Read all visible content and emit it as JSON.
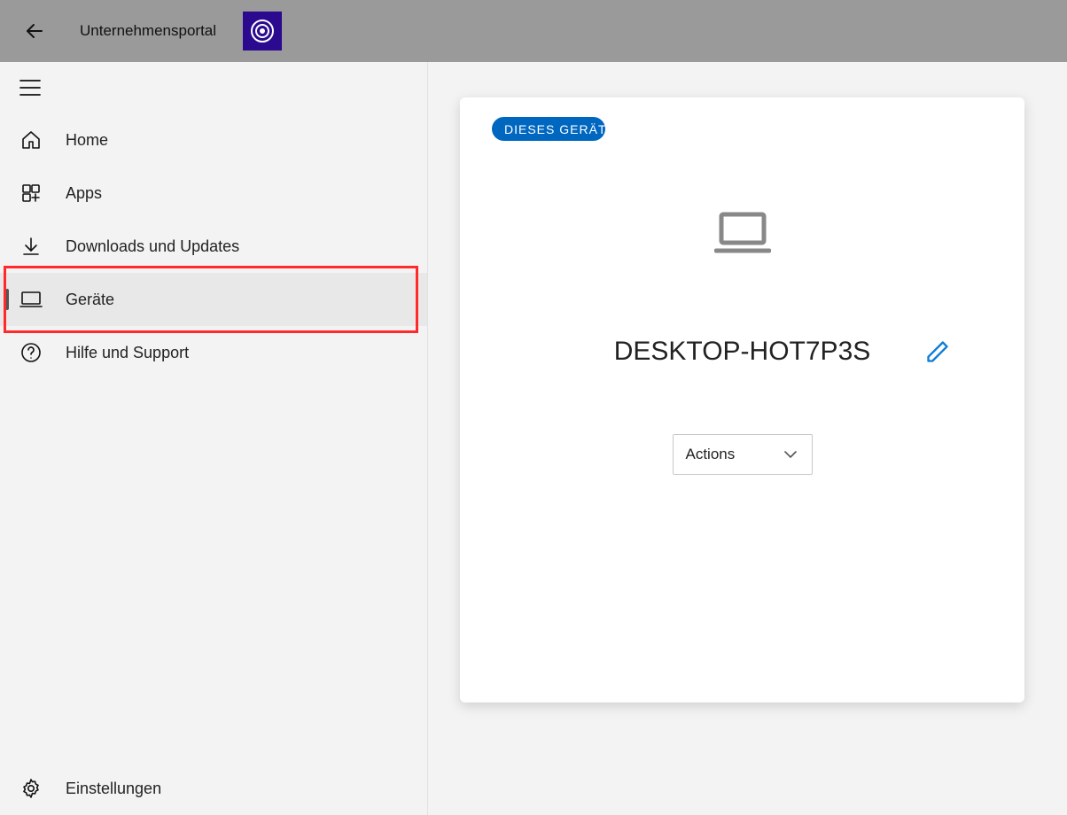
{
  "titlebar": {
    "app_title": "Unternehmensportal"
  },
  "sidebar": {
    "items": [
      {
        "label": "Home",
        "icon": "home-icon"
      },
      {
        "label": "Apps",
        "icon": "apps-icon"
      },
      {
        "label": "Downloads und Updates",
        "icon": "download-icon"
      },
      {
        "label": "Geräte",
        "icon": "device-icon",
        "selected": true,
        "highlight": true
      },
      {
        "label": "Hilfe und Support",
        "icon": "help-icon"
      }
    ],
    "settings_label": "Einstellungen"
  },
  "main": {
    "badge_label": "DIESES GERÄT",
    "device_name": "DESKTOP-HOT7P3S",
    "actions_label": "Actions"
  },
  "colors": {
    "accent": "#0067c0",
    "highlight": "#ff2a2a"
  }
}
